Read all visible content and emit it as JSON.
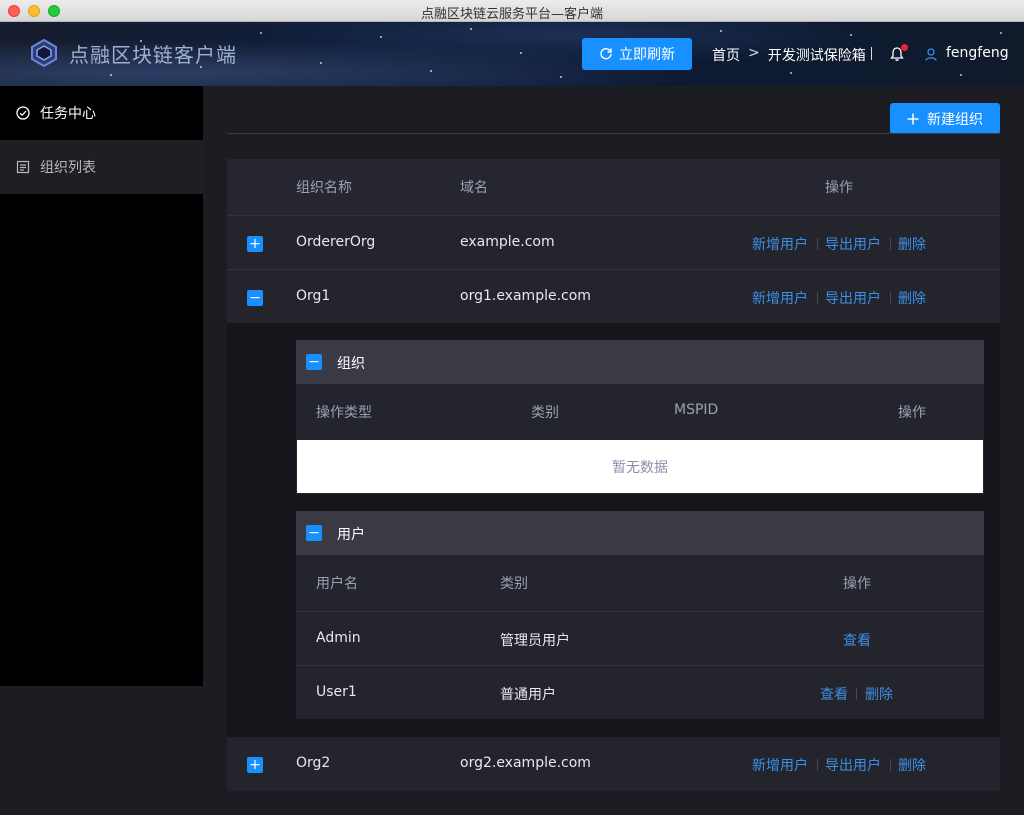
{
  "window": {
    "title": "点融区块链云服务平台—客户端"
  },
  "header": {
    "app_name": "点融区块链客户端",
    "refresh_label": "立即刷新",
    "breadcrumb": [
      "首页",
      "开发测试保险箱"
    ],
    "breadcrumb_sep": ">",
    "username": "fengfeng",
    "notification_dot_color": "#f5222d"
  },
  "sidebar": {
    "items": [
      {
        "label": "任务中心",
        "icon": "check-circle-icon"
      },
      {
        "label": "组织列表",
        "icon": "list-icon"
      }
    ]
  },
  "toolbar": {
    "new_org_label": "新建组织"
  },
  "org_table": {
    "columns": [
      "组织名称",
      "域名",
      "操作"
    ],
    "actions": [
      "新增用户",
      "导出用户",
      "删除"
    ],
    "rows": [
      {
        "name": "OrdererOrg",
        "domain": "example.com",
        "expander": "+"
      },
      {
        "name": "Org1",
        "domain": "org1.example.com",
        "expander": "−"
      },
      {
        "name": "Org2",
        "domain": "org2.example.com",
        "expander": "+"
      }
    ]
  },
  "org_panel": {
    "title": "组织",
    "expander": "−",
    "columns": [
      "操作类型",
      "类别",
      "MSPID",
      "操作"
    ],
    "empty_text": "暂无数据"
  },
  "user_panel": {
    "title": "用户",
    "expander": "−",
    "columns": [
      "用户名",
      "类别",
      "操作"
    ],
    "rows": [
      {
        "name": "Admin",
        "type": "管理员用户",
        "actions": [
          "查看"
        ]
      },
      {
        "name": "User1",
        "type": "普通用户",
        "actions": [
          "查看",
          "删除"
        ]
      }
    ]
  },
  "colors": {
    "accent": "#1890ff",
    "link": "#3c8fe6"
  }
}
